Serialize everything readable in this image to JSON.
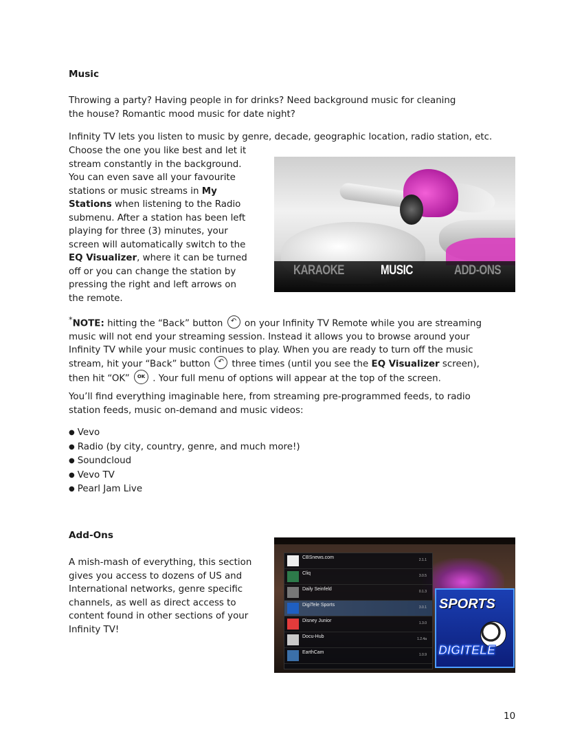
{
  "page": {
    "number": "10"
  },
  "music": {
    "heading": "Music",
    "intro_line1": "Throwing a party? Having people in for drinks? Need background music for cleaning",
    "intro_line2": "the house? Romantic mood music for date night?",
    "para2_line1": "Infinity TV lets you listen to music by genre, decade, geographic location, radio station, etc.",
    "para2_lines": [
      "Choose the one you like best and let it",
      "stream constantly in the background.",
      "You can even save all your favourite",
      "stations or music streams in "
    ],
    "my": "My",
    "stations_bold": "Stations",
    "para2_after_stations": " when listening to the Radio",
    "para2_more": [
      "submenu. After a station has been left",
      "playing for three (3) minutes, your",
      "screen will automatically switch to the"
    ],
    "eq_visualizer": "EQ Visualizer",
    "para2_after_eq": ", where it can be turned",
    "para2_tail": [
      "off or you can change the station by",
      "pressing the right and left arrows on",
      "the remote."
    ],
    "note": {
      "asterisk": "*",
      "label": "NOTE:",
      "line1_a": " hitting the “Back” button ",
      "line1_b": " on your Infinity TV Remote while you are streaming",
      "line2": "music will not end your streaming session. Instead it allows you to browse around your",
      "line3": "Infinity TV while your music continues to play. When you are ready to turn off the music",
      "line4_a": "stream, hit your “Back” button ",
      "line4_b": " three times (until you see the ",
      "line4_bold": "EQ Visualizer",
      "line4_c": " screen),",
      "line5_a": "then hit “OK” ",
      "line5_b": " . Your full menu of options will appear at the top of the screen.",
      "back_icon": "back-arrow-icon",
      "ok_icon_text": "OK"
    },
    "find_line1": "You’ll find everything imaginable here, from streaming pre-programmed feeds, to radio",
    "find_line2": "station feeds, music on-demand and music videos:",
    "bullets": [
      "Vevo",
      "Radio (by city, country, genre, and much more!)",
      "Soundcloud",
      "Vevo TV",
      "Pearl Jam Live"
    ],
    "image_menu": {
      "left": "KARAOKE",
      "center": "MUSIC",
      "right": "ADD-ONS"
    }
  },
  "addons": {
    "heading": "Add-Ons",
    "lines": [
      "A mish-mash of everything, this section",
      "gives you access to dozens of US and",
      "International networks, genre specific",
      "channels, as well as direct access to",
      "content found in other sections of your",
      "Infinity TV!"
    ],
    "image_list": [
      {
        "name": "CBSnews.com",
        "ver": "2.1.1"
      },
      {
        "name": "Cliq",
        "ver": "3.0.5"
      },
      {
        "name": "Daily Seinfeld",
        "ver": "0.1.3"
      },
      {
        "name": "DigiTele Sports",
        "ver": "3.0.1"
      },
      {
        "name": "Disney Junior",
        "ver": "1.3.0"
      },
      {
        "name": "Docu-Hub",
        "ver": "1.2.4a"
      },
      {
        "name": "EarthCam",
        "ver": "1.0.9"
      }
    ],
    "image_banner_top": "SPORTS",
    "image_banner_bottom": "DIGITELE"
  }
}
